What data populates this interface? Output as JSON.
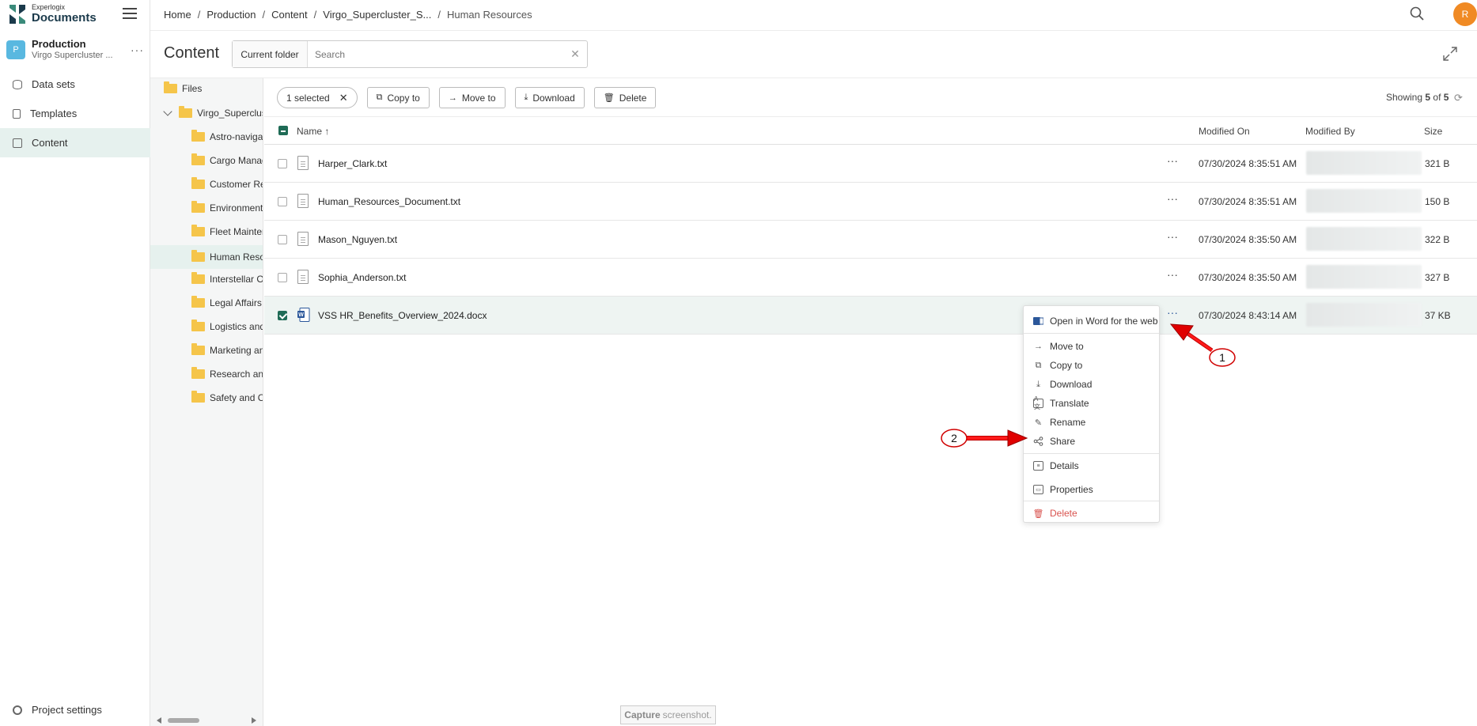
{
  "app": {
    "logo_small": "Experlogix",
    "logo_big": "Documents"
  },
  "project": {
    "initial": "P",
    "name": "Production",
    "subtitle": "Virgo Supercluster ..."
  },
  "sidebar": {
    "items": [
      {
        "label": "Data sets",
        "icon": "database-icon"
      },
      {
        "label": "Templates",
        "icon": "document-icon"
      },
      {
        "label": "Content",
        "icon": "content-icon"
      }
    ],
    "active": "Content",
    "settings_label": "Project settings"
  },
  "breadcrumb": [
    "Home",
    "Production",
    "Content",
    "Virgo_Supercluster_S...",
    "Human Resources"
  ],
  "user_initial": "R",
  "content": {
    "title": "Content",
    "scope_label": "Current folder",
    "search_placeholder": "Search"
  },
  "tree": {
    "root": "Files",
    "project_folder": "Virgo_Superclust",
    "folders": [
      "Astro-navigat",
      "Cargo Manag",
      "Customer Re",
      "Environment",
      "Fleet Mainter",
      "Human Reso",
      "Interstellar O",
      "Legal Affairs",
      "Logistics and",
      "Marketing an",
      "Research and",
      "Safety and C"
    ],
    "selected": "Human Reso"
  },
  "toolbar": {
    "selected_label": "1 selected",
    "copy_to": "Copy to",
    "move_to": "Move to",
    "download": "Download",
    "delete": "Delete"
  },
  "showing": {
    "prefix": "Showing",
    "count": "5",
    "of": "of",
    "total": "5"
  },
  "table": {
    "headers": {
      "name": "Name ↑",
      "modified_on": "Modified On",
      "modified_by": "Modified By",
      "size": "Size"
    },
    "rows": [
      {
        "name": "Harper_Clark.txt",
        "modified_on": "07/30/2024 8:35:51 AM",
        "size": "321 B",
        "type": "txt",
        "selected": false
      },
      {
        "name": "Human_Resources_Document.txt",
        "modified_on": "07/30/2024 8:35:51 AM",
        "size": "150 B",
        "type": "txt",
        "selected": false
      },
      {
        "name": "Mason_Nguyen.txt",
        "modified_on": "07/30/2024 8:35:50 AM",
        "size": "322 B",
        "type": "txt",
        "selected": false
      },
      {
        "name": "Sophia_Anderson.txt",
        "modified_on": "07/30/2024 8:35:50 AM",
        "size": "327 B",
        "type": "txt",
        "selected": false
      },
      {
        "name": "VSS HR_Benefits_Overview_2024.docx",
        "modified_on": "07/30/2024 8:43:14 AM",
        "size": "37 KB",
        "type": "docx",
        "selected": true
      }
    ]
  },
  "context_menu": {
    "open_word": "Open in Word for the web",
    "move_to": "Move to",
    "copy_to": "Copy to",
    "download": "Download",
    "translate": "Translate",
    "rename": "Rename",
    "share": "Share",
    "details": "Details",
    "properties": "Properties",
    "delete": "Delete"
  },
  "annotations": {
    "marker1": "1",
    "marker2": "2",
    "arrow_color": "#e00000"
  },
  "capture_hint": {
    "bold": "Capture",
    "rest": "screenshot."
  },
  "colors": {
    "accent": "#1f6b56",
    "active_bg": "#e6f1ee",
    "avatar": "#f08a24",
    "folder": "#f5c54a"
  }
}
